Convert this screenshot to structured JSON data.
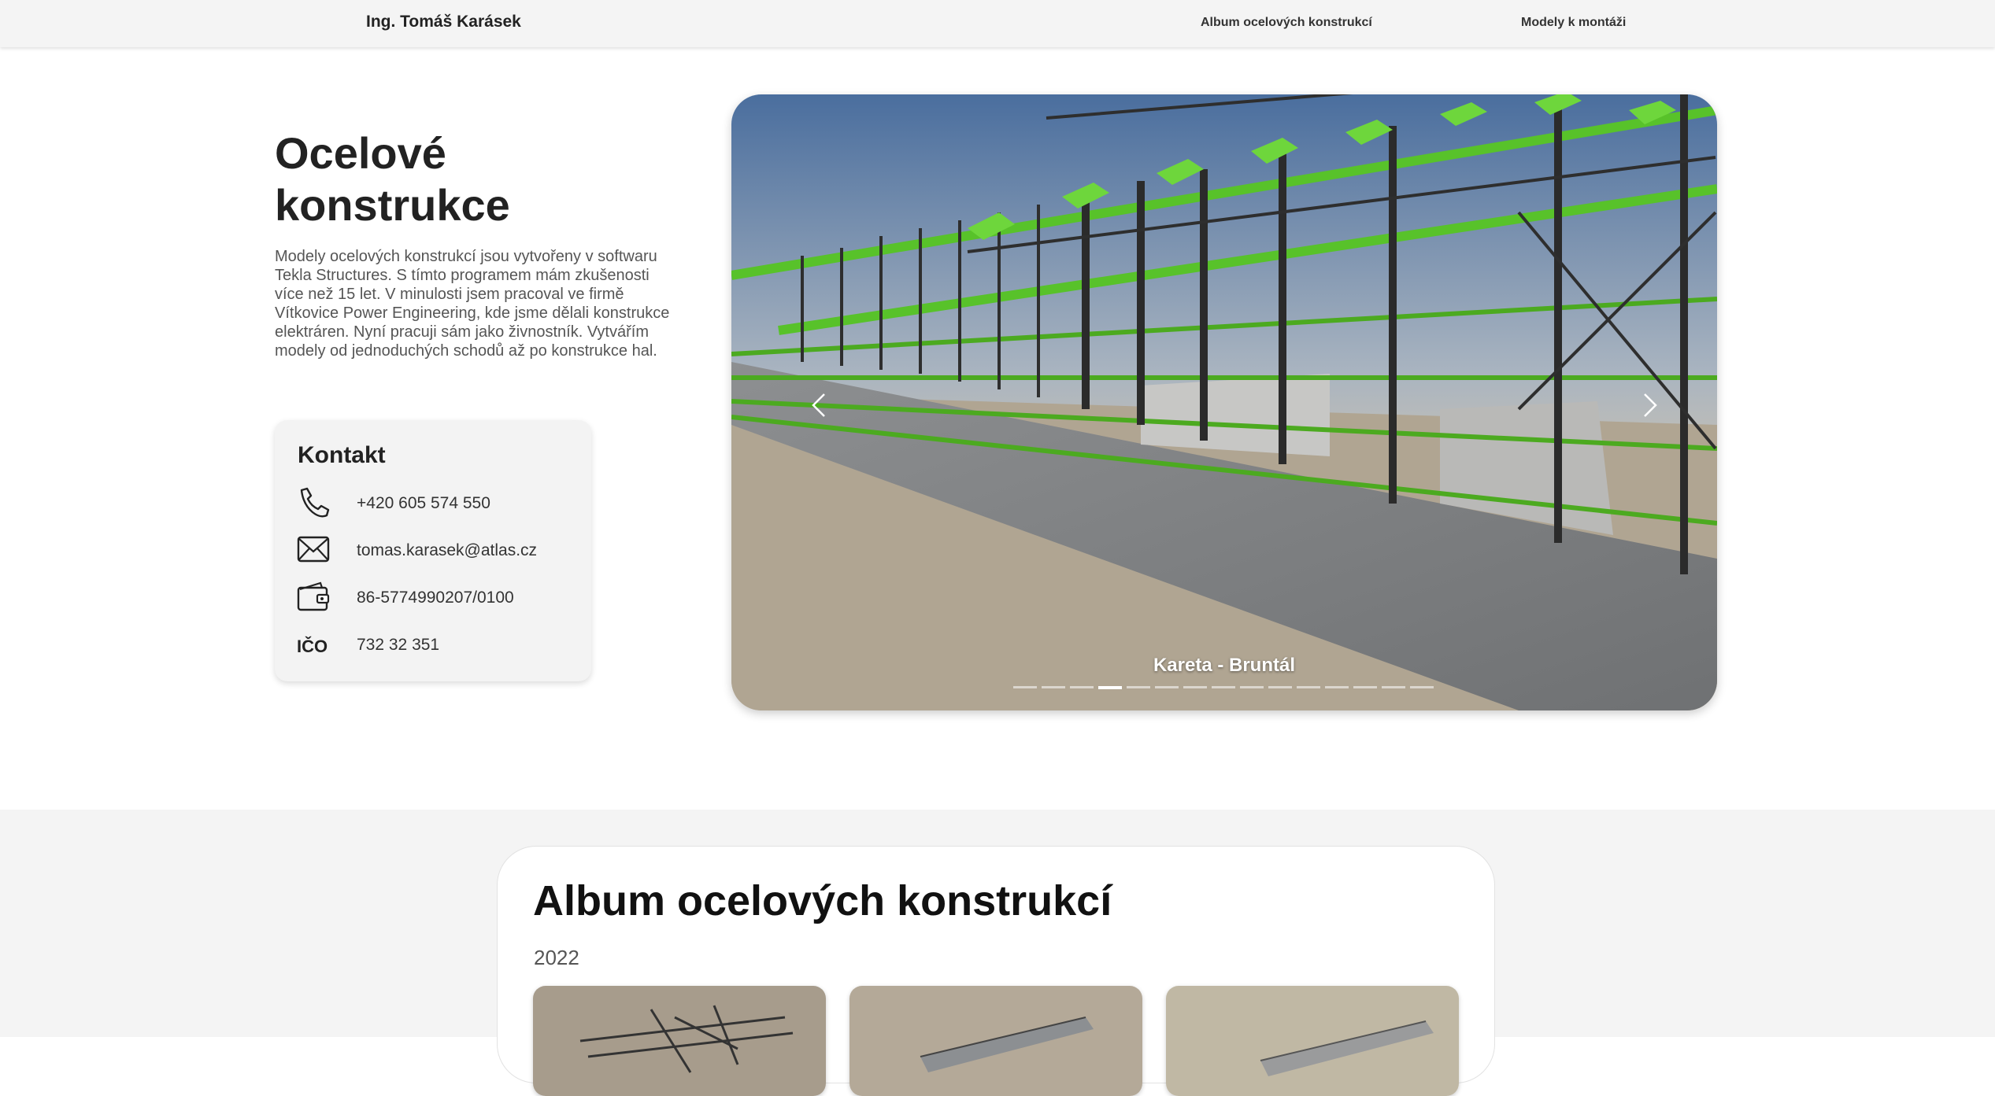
{
  "nav": {
    "brand": "Ing. Tomáš Karásek",
    "links": [
      "Album ocelových konstrukcí",
      "Modely k montáži"
    ]
  },
  "hero": {
    "title": "Ocelové konstrukce",
    "description": "Modely ocelových konstrukcí jsou vytvořeny v softwaru Tekla Structures. S tímto programem mám zkušenosti více než 15 let. V minulosti jsem pracoval ve firmě Vítkovice Power Engineering, kde jsme dělali konstrukce elektráren. Nyní pracuji sám jako živnostník. Vytvářím modely od jednoduchých schodů až po konstrukce hal."
  },
  "contact": {
    "title": "Kontakt",
    "phone": "+420 605 574 550",
    "email": "tomas.karasek@atlas.cz",
    "bank_account": "86-5774990207/0100",
    "ico_label": "IČO",
    "ico": "732 32 351",
    "icons": [
      "phone-icon",
      "envelope-icon",
      "wallet-icon"
    ]
  },
  "carousel": {
    "caption": "Kareta - Bruntál",
    "slide_count": 15,
    "active_index": 3
  },
  "album": {
    "title": "Album ocelových konstrukcí",
    "year": "2022",
    "thumbnail_count": 3
  }
}
